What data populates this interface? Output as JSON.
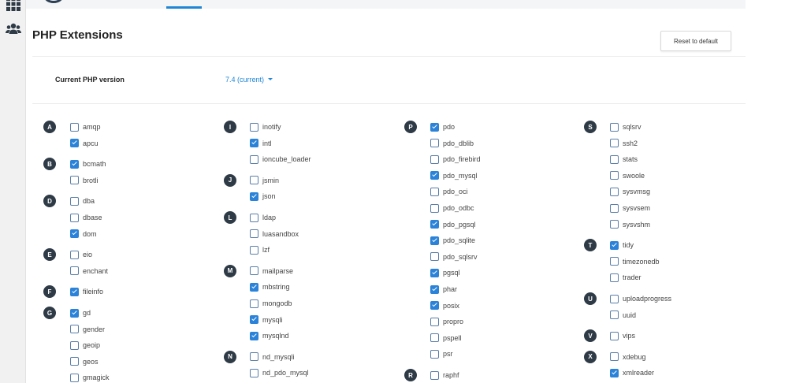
{
  "page": {
    "title": "PHP Extensions",
    "reset_label": "Reset to default",
    "version_label": "Current PHP version",
    "version_value": "7.4 (current)"
  },
  "sidebar": {
    "icons": [
      "apps-grid-icon",
      "users-icon"
    ]
  },
  "columns": [
    {
      "groups": [
        {
          "letter": "A",
          "items": [
            {
              "name": "amqp",
              "checked": false
            },
            {
              "name": "apcu",
              "checked": true
            }
          ]
        },
        {
          "letter": "B",
          "items": [
            {
              "name": "bcmath",
              "checked": true
            },
            {
              "name": "brotli",
              "checked": false
            }
          ]
        },
        {
          "letter": "D",
          "items": [
            {
              "name": "dba",
              "checked": false
            },
            {
              "name": "dbase",
              "checked": false
            },
            {
              "name": "dom",
              "checked": true
            }
          ]
        },
        {
          "letter": "E",
          "items": [
            {
              "name": "eio",
              "checked": false
            },
            {
              "name": "enchant",
              "checked": false
            }
          ]
        },
        {
          "letter": "F",
          "items": [
            {
              "name": "fileinfo",
              "checked": true
            }
          ]
        },
        {
          "letter": "G",
          "items": [
            {
              "name": "gd",
              "checked": true
            },
            {
              "name": "gender",
              "checked": false
            },
            {
              "name": "geoip",
              "checked": false
            },
            {
              "name": "geos",
              "checked": false
            },
            {
              "name": "gmagick",
              "checked": false
            }
          ]
        }
      ]
    },
    {
      "groups": [
        {
          "letter": "I",
          "items": [
            {
              "name": "inotify",
              "checked": false
            },
            {
              "name": "intl",
              "checked": true
            },
            {
              "name": "ioncube_loader",
              "checked": false
            }
          ]
        },
        {
          "letter": "J",
          "items": [
            {
              "name": "jsmin",
              "checked": false
            },
            {
              "name": "json",
              "checked": true
            }
          ]
        },
        {
          "letter": "L",
          "items": [
            {
              "name": "ldap",
              "checked": false
            },
            {
              "name": "luasandbox",
              "checked": false
            },
            {
              "name": "lzf",
              "checked": false
            }
          ]
        },
        {
          "letter": "M",
          "items": [
            {
              "name": "mailparse",
              "checked": false
            },
            {
              "name": "mbstring",
              "checked": true
            },
            {
              "name": "mongodb",
              "checked": false
            },
            {
              "name": "mysqli",
              "checked": true
            },
            {
              "name": "mysqlnd",
              "checked": true
            }
          ]
        },
        {
          "letter": "N",
          "items": [
            {
              "name": "nd_mysqli",
              "checked": false
            },
            {
              "name": "nd_pdo_mysql",
              "checked": false
            }
          ]
        }
      ]
    },
    {
      "groups": [
        {
          "letter": "P",
          "items": [
            {
              "name": "pdo",
              "checked": true
            },
            {
              "name": "pdo_dblib",
              "checked": false
            },
            {
              "name": "pdo_firebird",
              "checked": false
            },
            {
              "name": "pdo_mysql",
              "checked": true
            },
            {
              "name": "pdo_oci",
              "checked": false
            },
            {
              "name": "pdo_odbc",
              "checked": false
            },
            {
              "name": "pdo_pgsql",
              "checked": true
            },
            {
              "name": "pdo_sqlite",
              "checked": true
            },
            {
              "name": "pdo_sqlsrv",
              "checked": false
            },
            {
              "name": "pgsql",
              "checked": true
            },
            {
              "name": "phar",
              "checked": true
            },
            {
              "name": "posix",
              "checked": true
            },
            {
              "name": "propro",
              "checked": false
            },
            {
              "name": "pspell",
              "checked": false
            },
            {
              "name": "psr",
              "checked": false
            }
          ]
        },
        {
          "letter": "R",
          "items": [
            {
              "name": "raphf",
              "checked": false
            }
          ]
        }
      ]
    },
    {
      "groups": [
        {
          "letter": "S",
          "items": [
            {
              "name": "sqlsrv",
              "checked": false
            },
            {
              "name": "ssh2",
              "checked": false
            },
            {
              "name": "stats",
              "checked": false
            },
            {
              "name": "swoole",
              "checked": false
            },
            {
              "name": "sysvmsg",
              "checked": false
            },
            {
              "name": "sysvsem",
              "checked": false
            },
            {
              "name": "sysvshm",
              "checked": false
            }
          ]
        },
        {
          "letter": "T",
          "items": [
            {
              "name": "tidy",
              "checked": true
            },
            {
              "name": "timezonedb",
              "checked": false
            },
            {
              "name": "trader",
              "checked": false
            }
          ]
        },
        {
          "letter": "U",
          "items": [
            {
              "name": "uploadprogress",
              "checked": false
            },
            {
              "name": "uuid",
              "checked": false
            }
          ]
        },
        {
          "letter": "V",
          "items": [
            {
              "name": "vips",
              "checked": false
            }
          ]
        },
        {
          "letter": "X",
          "items": [
            {
              "name": "xdebug",
              "checked": false
            },
            {
              "name": "xmlreader",
              "checked": true
            }
          ]
        }
      ]
    }
  ]
}
